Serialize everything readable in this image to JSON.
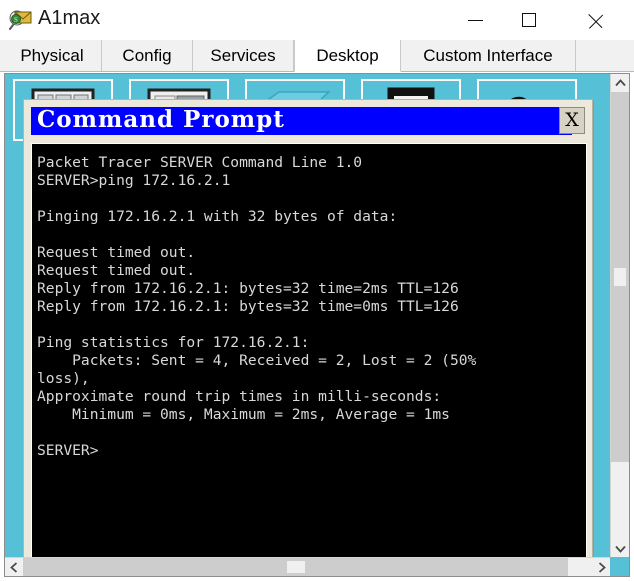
{
  "window": {
    "title": "A1max",
    "icon": "packet-tracer-icon",
    "controls": {
      "minimize": "minimize-icon",
      "maximize": "maximize-icon",
      "close": "close-icon"
    }
  },
  "tabs": [
    {
      "label": "Physical",
      "active": false
    },
    {
      "label": "Config",
      "active": false
    },
    {
      "label": "Services",
      "active": false
    },
    {
      "label": "Desktop",
      "active": true
    },
    {
      "label": "Custom Interface",
      "active": false
    }
  ],
  "desktop": {
    "background_color": "#55c0d6",
    "icons": [
      {
        "name": "desktop-icon-1"
      },
      {
        "name": "desktop-icon-2"
      },
      {
        "name": "desktop-icon-3"
      },
      {
        "name": "desktop-icon-4"
      },
      {
        "name": "desktop-icon-5"
      }
    ],
    "scrollbars": {
      "up_arrow": "⌃",
      "down_arrow": "⌄",
      "left_arrow": "‹",
      "right_arrow": "›"
    }
  },
  "command_prompt": {
    "title": "Command Prompt",
    "title_bar_color": "#0000FF",
    "close_label": "X",
    "console_background": "#000000",
    "console_text_color": "#D8D8D8",
    "output": "Packet Tracer SERVER Command Line 1.0\nSERVER>ping 172.16.2.1\n\nPinging 172.16.2.1 with 32 bytes of data:\n\nRequest timed out.\nRequest timed out.\nReply from 172.16.2.1: bytes=32 time=2ms TTL=126\nReply from 172.16.2.1: bytes=32 time=0ms TTL=126\n\nPing statistics for 172.16.2.1:\n    Packets: Sent = 4, Received = 2, Lost = 2 (50%\nloss),\nApproximate round trip times in milli-seconds:\n    Minimum = 0ms, Maximum = 2ms, Average = 1ms\n\nSERVER>"
  }
}
